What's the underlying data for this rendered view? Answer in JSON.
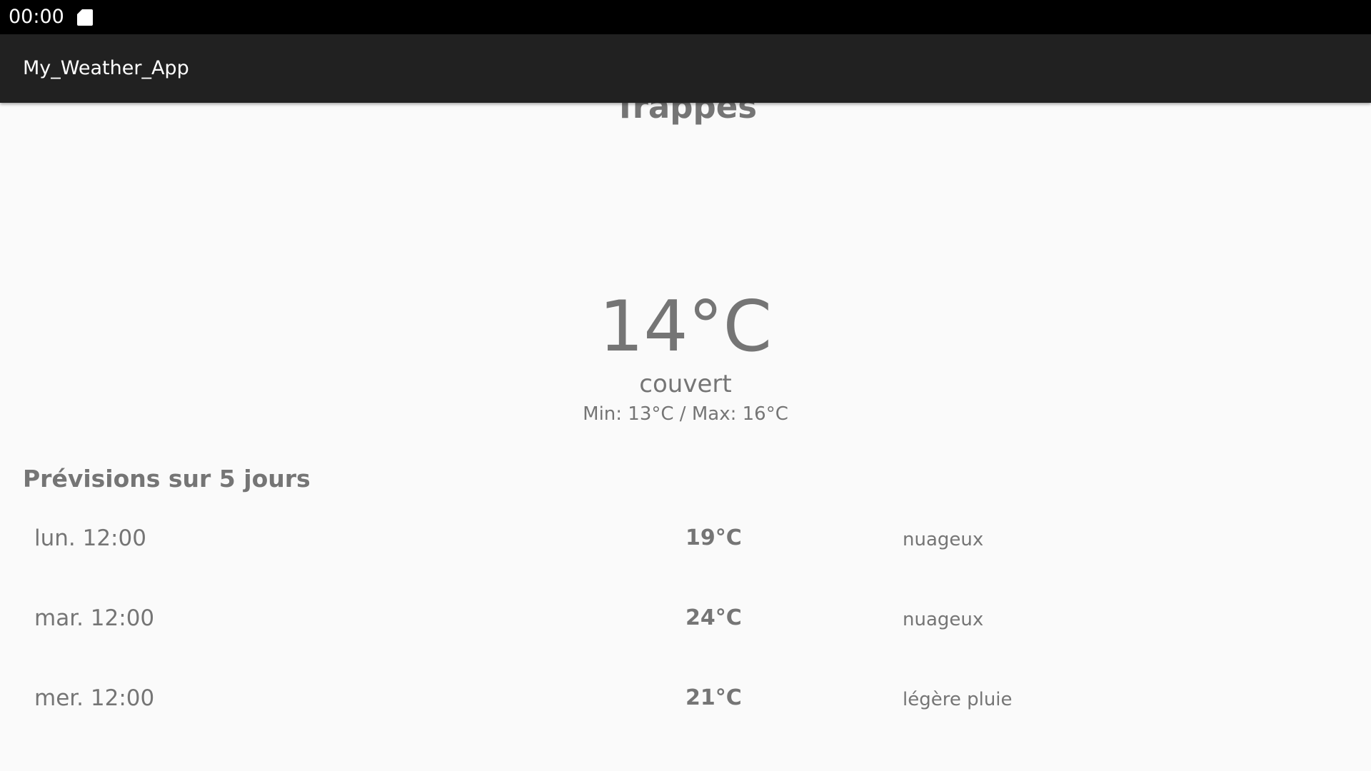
{
  "status_bar": {
    "time": "00:00",
    "icon": "sd-card-icon"
  },
  "app_bar": {
    "title": "My_Weather_App"
  },
  "current": {
    "city": "Trappes",
    "temperature": "14°C",
    "description": "couvert",
    "min_max": "Min: 13°C / Max: 16°C"
  },
  "forecast": {
    "heading": "Prévisions sur 5 jours",
    "rows": [
      {
        "date": "lun. 12:00",
        "temp": "19°C",
        "desc": "nuageux"
      },
      {
        "date": "mar. 12:00",
        "temp": "24°C",
        "desc": "nuageux"
      },
      {
        "date": "mer. 12:00",
        "temp": "21°C",
        "desc": "légère pluie"
      }
    ]
  },
  "colors": {
    "status_bar": "#000000",
    "app_bar": "#212121",
    "background": "#fafafa",
    "text": "#757575"
  }
}
